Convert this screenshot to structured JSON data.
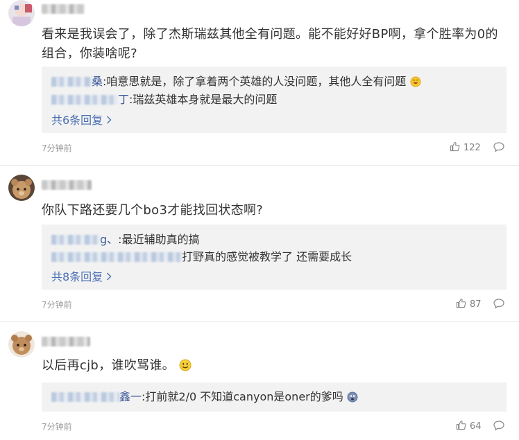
{
  "comments": [
    {
      "text": "看来是我误会了，除了杰斯瑞兹其他全有问题。能不能好好BP啊，拿个胜率为0的组合，你装啥呢?",
      "replies": [
        {
          "name_tail": "桑",
          "text": ":咱意思就是，除了拿着两个英雄的人没问题，其他人全有问题"
        },
        {
          "name_tail": "丁",
          "text": ":瑞兹英雄本身就是最大的问题"
        }
      ],
      "more_replies": "共6条回复",
      "time": "7分钟前",
      "likes": "122"
    },
    {
      "text": "你队下路还要几个bo3才能找回状态啊?",
      "replies": [
        {
          "name_tail": "g、",
          "text": ":最近辅助真的搞"
        },
        {
          "name_tail": "",
          "text": "打野真的感觉被教学了 还需要成长"
        }
      ],
      "more_replies": "共8条回复",
      "time": "7分钟前",
      "likes": "87"
    },
    {
      "text": "以后再cjb，谁吹骂谁。",
      "replies": [
        {
          "name_tail": "鑫一",
          "text": ":打前就2/0 不知道canyon是oner的爹吗"
        }
      ],
      "time": "7分钟前",
      "likes": "64"
    }
  ],
  "icons": {
    "like": "thumbs-up-icon",
    "reply": "speech-bubble-icon",
    "more": "chevron-right-icon"
  },
  "colors": {
    "link": "#4a6fb5",
    "reply_bg": "#f2f2f2",
    "meta": "#9a9a9a"
  }
}
